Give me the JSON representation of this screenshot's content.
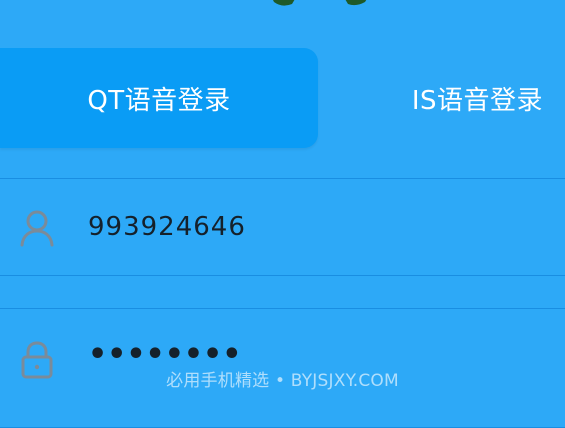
{
  "tabs": {
    "qt_label": "QT语音登录",
    "is_label": "IS语音登录"
  },
  "login": {
    "username_value": "993924646",
    "password_value": "••••••••"
  },
  "watermark": {
    "text": "必用手机精选 • BYJSJXY.COM"
  },
  "colors": {
    "background": "#2DA9F7",
    "active_tab": "#0A9CF5",
    "text_dark": "#15212B",
    "icon_gray": "#7A8B9A",
    "logo_green": "#1E5A2A"
  },
  "icons": {
    "username": "user-icon",
    "password": "lock-icon"
  }
}
